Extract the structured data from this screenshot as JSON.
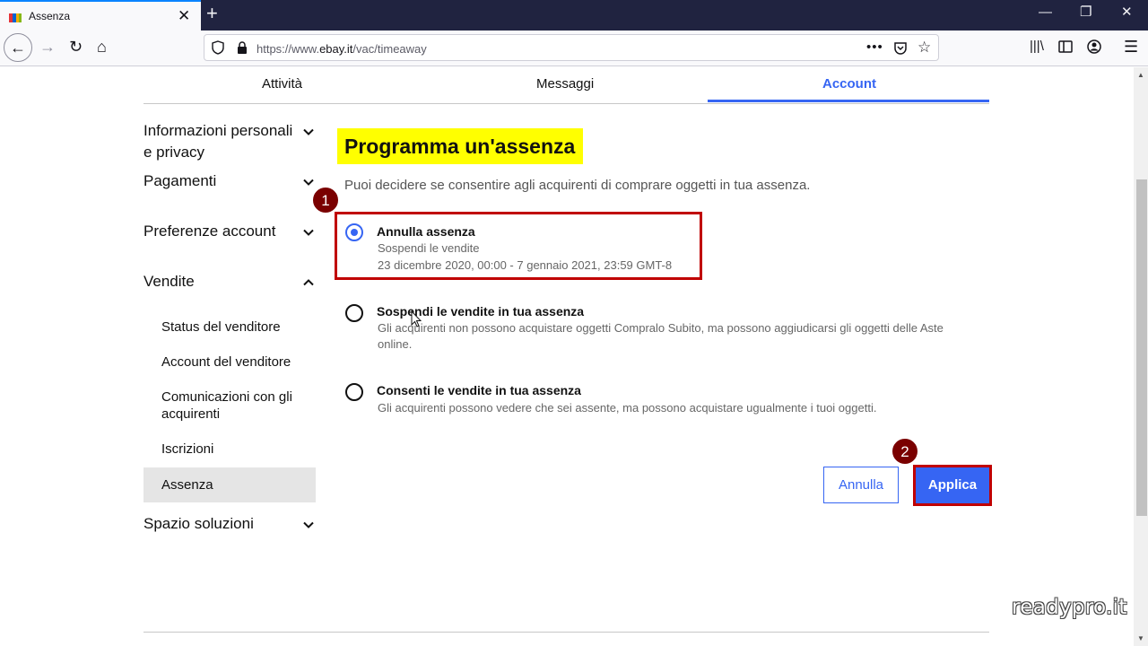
{
  "browser": {
    "tab_title": "Assenza",
    "url_prefix": "https://www.",
    "url_domain": "ebay.it",
    "url_path": "/vac/timeaway"
  },
  "top_tabs": [
    {
      "label": "Attività",
      "active": false
    },
    {
      "label": "Messaggi",
      "active": false
    },
    {
      "label": "Account",
      "active": true
    }
  ],
  "sidebar": {
    "groups": [
      {
        "label": "Informazioni personali e privacy",
        "expanded": false
      },
      {
        "label": "Pagamenti",
        "expanded": false
      },
      {
        "label": "Preferenze account",
        "expanded": false
      },
      {
        "label": "Vendite",
        "expanded": true
      },
      {
        "label": "Spazio soluzioni",
        "expanded": false
      }
    ],
    "sub_items": [
      {
        "label": "Status del venditore",
        "active": false
      },
      {
        "label": "Account del venditore",
        "active": false
      },
      {
        "label": "Comunicazioni con gli acquirenti",
        "active": false
      },
      {
        "label": "Iscrizioni",
        "active": false
      },
      {
        "label": "Assenza",
        "active": true
      }
    ]
  },
  "main": {
    "heading": "Programma un'assenza",
    "intro": "Puoi decidere se consentire agli acquirenti di comprare oggetti in tua assenza.",
    "options": [
      {
        "title": "Annulla assenza",
        "line1": "Sospendi le vendite",
        "line2": "23 dicembre 2020, 00:00 - 7 gennaio 2021, 23:59 GMT-8",
        "selected": true
      },
      {
        "title": "Sospendi le vendite in tua assenza",
        "line1": "Gli acquirenti non possono acquistare oggetti Compralo Subito, ma possono aggiudicarsi gli oggetti delle Aste online.",
        "selected": false
      },
      {
        "title": "Consenti le vendite in tua assenza",
        "line1": "Gli acquirenti possono vedere che sei assente, ma possono acquistare ugualmente i tuoi oggetti.",
        "selected": false
      }
    ],
    "cancel_label": "Annulla",
    "apply_label": "Applica"
  },
  "annotations": {
    "marker1": "1",
    "marker2": "2",
    "highlight_color": "#c00000"
  },
  "watermark": "readypro.it",
  "colors": {
    "accent": "#3665f3",
    "heading_highlight": "#ffff00",
    "tabbar": "#202340"
  }
}
